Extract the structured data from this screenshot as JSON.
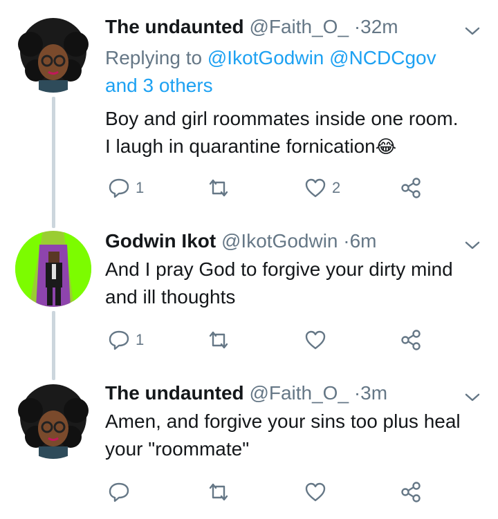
{
  "tweets": [
    {
      "name": "The undaunted",
      "handle": "@Faith_O_",
      "dot": "·",
      "time": "32m",
      "reply_prefix": "Replying to",
      "reply_users": "@IkotGodwin @NCDCgov",
      "reply_others": "and 3 others",
      "text_lines": [
        "Boy and girl roommates inside one room.",
        "I laugh in quarantine fornication"
      ],
      "emoji": "😂",
      "reply_count": "1",
      "retweet_count": "",
      "like_count": "2"
    },
    {
      "name": "Godwin Ikot",
      "handle": "@IkotGodwin",
      "dot": "·",
      "time": "6m",
      "text_lines": [
        "And I pray God to forgive your dirty mind",
        "and ill thoughts"
      ],
      "reply_count": "1",
      "retweet_count": "",
      "like_count": ""
    },
    {
      "name": "The undaunted",
      "handle": "@Faith_O_",
      "dot": "·",
      "time": "3m",
      "text_lines": [
        "Amen, and forgive your sins too plus heal",
        "your \"roommate\""
      ],
      "reply_count": "",
      "retweet_count": "",
      "like_count": ""
    }
  ],
  "colors": {
    "icon": "#657786",
    "link": "#1da1f2",
    "thread_line": "#ccd6dd"
  },
  "icons": [
    "reply-icon",
    "retweet-icon",
    "like-icon",
    "share-icon",
    "chevron-down-icon"
  ]
}
